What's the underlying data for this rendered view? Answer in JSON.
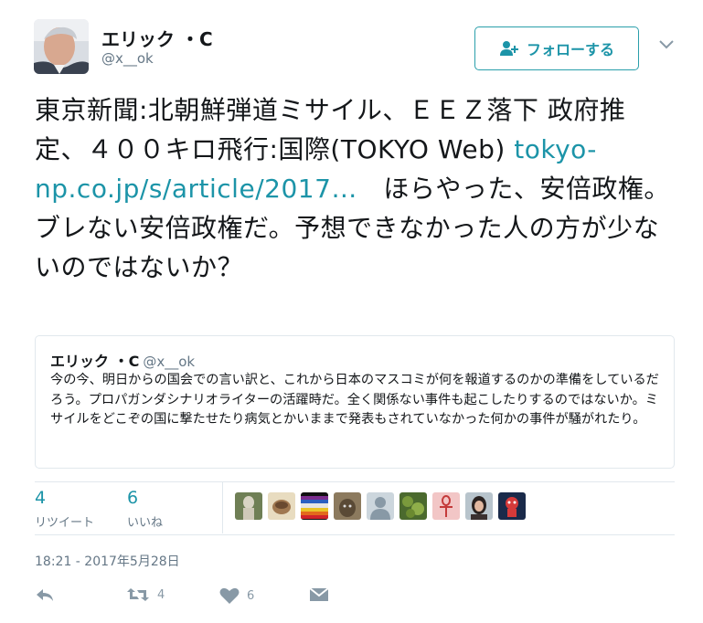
{
  "author": {
    "name": "エリック ・C",
    "handle": "@x__ok"
  },
  "follow_button": {
    "label": "フォローする"
  },
  "tweet": {
    "text_before_link": "東京新聞:北朝鮮弾道ミサイル、ＥＥＺ落下 政府推定、４００キロ飛行:国際(TOKYO Web) ",
    "link_text": "tokyo-np.co.jp/s/article/2017…",
    "text_after_link": "　ほらやった、安倍政権。ブレない安倍政権だ。予想できなかった人の方が少ないのではないか？"
  },
  "quoted_tweet": {
    "name": "エリック ・C",
    "handle": "@x__ok",
    "text": "今の今、明日からの国会での言い訳と、これから日本のマスコミが何を報道するのかの準備をしているだろう。プロパガンダシナリオライターの活躍時だ。全く関係ない事件も起こしたりするのではないか。ミサイルをどこぞの国に撃たせたり病気とかいままで発表もされていなかった何かの事件が騒がれたり。"
  },
  "stats": {
    "retweets": {
      "count": "4",
      "label": "リツイート"
    },
    "likes": {
      "count": "6",
      "label": "いいね"
    }
  },
  "likers": [
    {
      "icon": "liker-avatar-statue"
    },
    {
      "icon": "liker-avatar-cup"
    },
    {
      "icon": "liker-avatar-peace-flag"
    },
    {
      "icon": "liker-avatar-cat"
    },
    {
      "icon": "liker-avatar-default"
    },
    {
      "icon": "liker-avatar-leaves"
    },
    {
      "icon": "liker-avatar-ankh"
    },
    {
      "icon": "liker-avatar-woman"
    },
    {
      "icon": "liker-avatar-red-character"
    }
  ],
  "timestamp": "18:21 - 2017年5月28日",
  "actions": {
    "retweet_count": "4",
    "like_count": "6"
  },
  "colors": {
    "accent": "#1c94a8",
    "text": "#14171a",
    "muted": "#657786",
    "border": "#e1e8ed"
  }
}
